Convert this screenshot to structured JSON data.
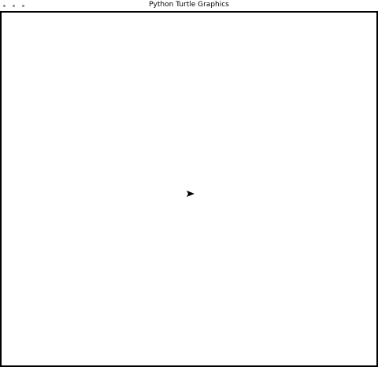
{
  "window": {
    "title": "Python Turtle Graphics"
  },
  "canvas": {
    "background": "#ffffff",
    "border_color": "#000000"
  },
  "turtle": {
    "shape": "arrow",
    "heading_degrees": 0,
    "color": "#000000"
  }
}
